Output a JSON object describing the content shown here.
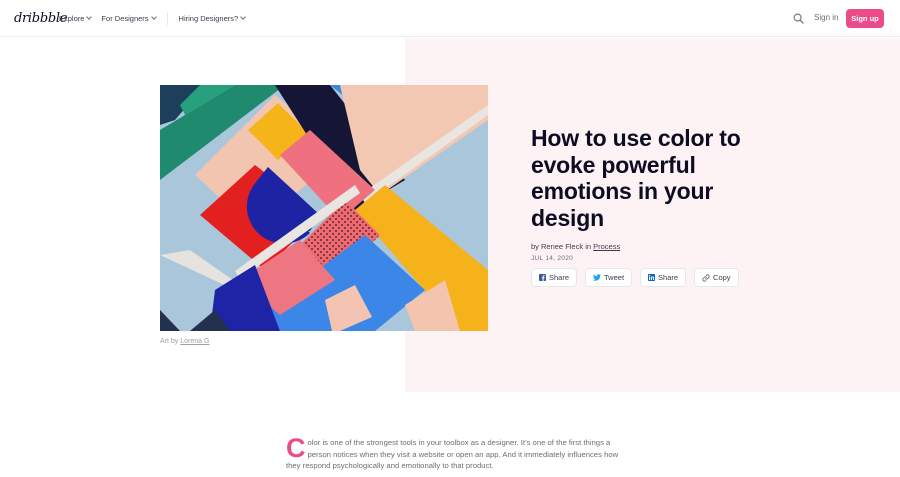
{
  "nav": {
    "logo": "dribbble",
    "menu": [
      {
        "label": "Explore"
      },
      {
        "label": "For Designers"
      },
      {
        "label": "Hiring Designers?"
      }
    ],
    "signin_label": "Sign in",
    "signup_label": "Sign up"
  },
  "article": {
    "title": "How to use color to evoke powerful emotions in your design",
    "byline_prefix": "by Renee Fleck in ",
    "category": "Process",
    "date": "JUL 14, 2020",
    "art_caption_prefix": "Art by ",
    "art_author": "Lorena G",
    "share": [
      {
        "label": "Share",
        "icon": "facebook-icon"
      },
      {
        "label": "Tweet",
        "icon": "twitter-icon"
      },
      {
        "label": "Share",
        "icon": "linkedin-icon"
      },
      {
        "label": "Copy",
        "icon": "link-icon"
      }
    ],
    "intro_dropcap": "C",
    "intro_text": "olor is one of the strongest tools in your toolbox as a designer. It’s one of the first things a person notices when they visit a website or open an app. And it immediately influences how they respond psychologically and emotionally to that product."
  },
  "colors": {
    "brand_pink": "#ea4c89",
    "hero_bg": "#fdf3f4",
    "text_dark": "#0d0c22"
  }
}
